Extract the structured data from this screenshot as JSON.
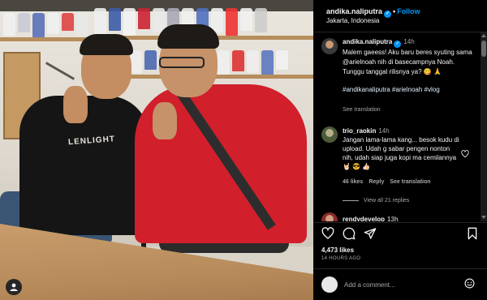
{
  "post": {
    "username": "andika.naliputra",
    "follow_label": "Follow",
    "separator": "•",
    "location": "Jakarta, Indonesia",
    "caption_username": "andika.naliputra",
    "caption_time": "14h",
    "caption_text": "Malem gaeess! Aku baru beres syuting sama @arielnoah nih di basecampnya Noah. Tunggu tanggal rilisnya ya? 😋 🙏",
    "caption_hashtags": "#andikanaliputra #arielnoah #vlog",
    "see_translation": "See translation",
    "shirt_print": "LENLIGHT"
  },
  "comments": [
    {
      "username": "trio_raokin",
      "time": "14h",
      "text": "Jangan lama-lama kang... besok kudu di upload. Udah g sabar pengen nonton nih, udah siap juga kopi ma cemilannya 🤘🏻 😎 👍🏻",
      "likes": "46 likes",
      "reply": "Reply",
      "see_translation": "See translation",
      "view_replies": "View all 21 replies"
    },
    {
      "username": "rendydevelop",
      "time": "13h"
    }
  ],
  "actions": {
    "like_icon": "heart-icon",
    "comment_icon": "comment-icon",
    "share_icon": "share-icon",
    "save_icon": "bookmark-icon"
  },
  "stats": {
    "likes": "4,473 likes",
    "posted": "14 HOURS AGO"
  },
  "composer": {
    "placeholder": "Add a comment..."
  },
  "colors": {
    "background": "#000000",
    "follow": "#0095f6",
    "verified": "#0095f6",
    "muted": "#a8a8a8"
  }
}
